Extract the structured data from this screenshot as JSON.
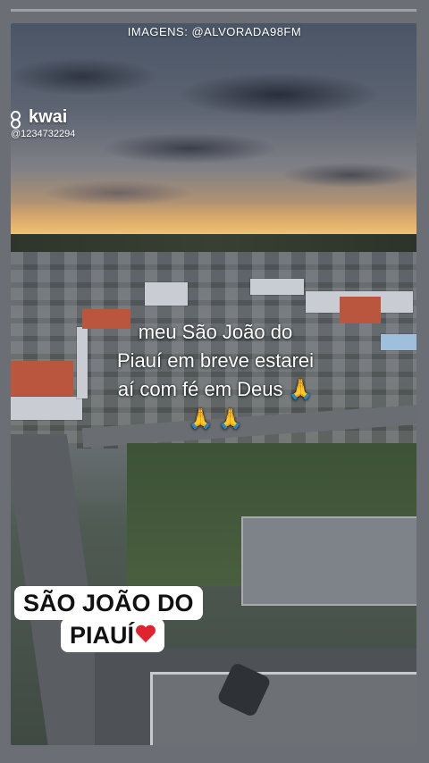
{
  "watermark": {
    "text": "IMAGENS: @ALVORADA98FM"
  },
  "kwai": {
    "brand": "kwai",
    "handle": "@1234732294",
    "icon": "kwai-logo-icon"
  },
  "caption": {
    "line1": "meu São João do",
    "line2": "Piauí em breve estarei",
    "line3": "aí com fé em Deus",
    "emoji": "🙏"
  },
  "stamp": {
    "line1": "SÃO JOÃO DO",
    "line2": "PIAUÍ",
    "heart_icon": "red-heart-icon",
    "heart_color": "#e0242d"
  }
}
